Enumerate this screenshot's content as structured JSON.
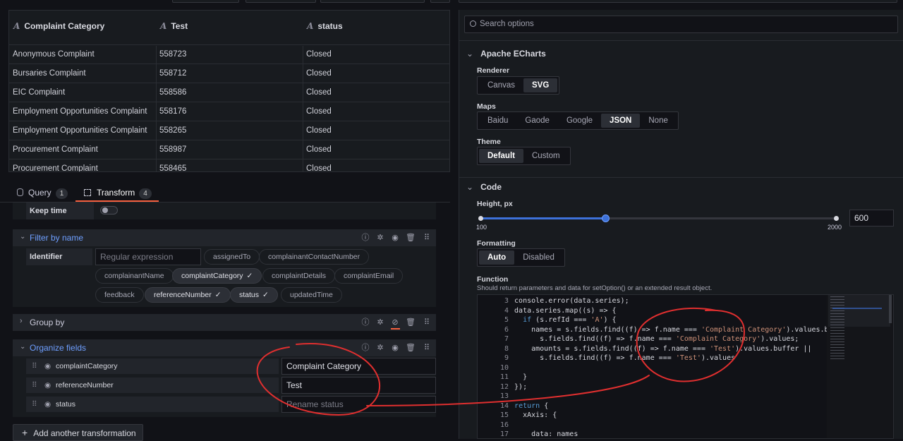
{
  "table": {
    "columns": [
      {
        "icon": "A",
        "label": "Complaint Category"
      },
      {
        "icon": "A",
        "label": "Test"
      },
      {
        "icon": "A",
        "label": "status"
      }
    ],
    "rows": [
      [
        "Anonymous Complaint",
        "558723",
        "Closed"
      ],
      [
        "Bursaries Complaint",
        "558712",
        "Closed"
      ],
      [
        "EIC Complaint",
        "558586",
        "Closed"
      ],
      [
        "Employment Opportunities Complaint",
        "558176",
        "Closed"
      ],
      [
        "Employment Opportunities Complaint",
        "558265",
        "Closed"
      ],
      [
        "Procurement Complaint",
        "558987",
        "Closed"
      ],
      [
        "Procurement Complaint",
        "558465",
        "Closed"
      ]
    ]
  },
  "tabs": {
    "query": {
      "label": "Query",
      "count": "1"
    },
    "transform": {
      "label": "Transform",
      "count": "4"
    }
  },
  "keep_time": {
    "label": "Keep time"
  },
  "filter_by_name": {
    "title": "Filter by name",
    "identifier_label": "Identifier",
    "regex_placeholder": "Regular expression pattern",
    "fields": [
      {
        "label": "assignedTo",
        "selected": false
      },
      {
        "label": "complainantContactNumber",
        "selected": false
      },
      {
        "label": "complainantName",
        "selected": false
      },
      {
        "label": "complaintCategory",
        "selected": true
      },
      {
        "label": "complaintDetails",
        "selected": false
      },
      {
        "label": "complaintEmail",
        "selected": false
      },
      {
        "label": "feedback",
        "selected": false
      },
      {
        "label": "referenceNumber",
        "selected": true
      },
      {
        "label": "status",
        "selected": true
      },
      {
        "label": "updatedTime",
        "selected": false
      }
    ],
    "check": "✓"
  },
  "group_by": {
    "title": "Group by"
  },
  "organize_fields": {
    "title": "Organize fields",
    "fields": [
      {
        "name": "complaintCategory",
        "rename_value": "Complaint Category",
        "rename_placeholder": ""
      },
      {
        "name": "referenceNumber",
        "rename_value": "Test",
        "rename_placeholder": ""
      },
      {
        "name": "status",
        "rename_value": "",
        "rename_placeholder": "Rename status"
      }
    ]
  },
  "add_transformation": {
    "label": "Add another transformation"
  },
  "options": {
    "search_placeholder": "Search options",
    "echarts": {
      "title": "Apache ECharts",
      "renderer": {
        "label": "Renderer",
        "options": [
          "Canvas",
          "SVG"
        ],
        "selected": "SVG"
      },
      "maps": {
        "label": "Maps",
        "options": [
          "Baidu",
          "Gaode",
          "Google",
          "JSON",
          "None"
        ],
        "selected": "JSON"
      },
      "theme": {
        "label": "Theme",
        "options": [
          "Default",
          "Custom"
        ],
        "selected": "Default"
      }
    },
    "code": {
      "title": "Code",
      "height": {
        "label": "Height, px",
        "min": "100",
        "max": "2000",
        "value": "600",
        "slider_fraction": 0.35
      },
      "formatting": {
        "label": "Formatting",
        "options": [
          "Auto",
          "Disabled"
        ],
        "selected": "Auto"
      },
      "function": {
        "label": "Function",
        "description": "Should return parameters and data for setOption() or an extended result object.",
        "lines": [
          {
            "n": "3",
            "text": "  console.error(data.series);"
          },
          {
            "n": "4",
            "text": "  data.series.map((s) => {"
          },
          {
            "n": "5",
            "text": "    if (s.refId === 'A') {"
          },
          {
            "n": "6",
            "text": "      names = s.fields.find((f) => f.name === 'Complaint Category').values.buffer ||"
          },
          {
            "n": "7",
            "text": "        s.fields.find((f) => f.name === 'Complaint Category').values;"
          },
          {
            "n": "8",
            "text": "      amounts = s.fields.find((f) => f.name === 'Test').values.buffer ||"
          },
          {
            "n": "9",
            "text": "        s.fields.find((f) => f.name === 'Test').values"
          },
          {
            "n": "10",
            "text": ""
          },
          {
            "n": "11",
            "text": "    }"
          },
          {
            "n": "12",
            "text": "  });"
          },
          {
            "n": "13",
            "text": ""
          },
          {
            "n": "14",
            "text": "  return {"
          },
          {
            "n": "15",
            "text": "    xAxis: {"
          },
          {
            "n": "16",
            "text": ""
          },
          {
            "n": "17",
            "text": "      data: names"
          }
        ]
      }
    }
  },
  "colors": {
    "accent": "#6e9fff",
    "tab_underline": "#f55f3e",
    "annotation": "#e02f2f",
    "slider": "#3d71d9"
  }
}
